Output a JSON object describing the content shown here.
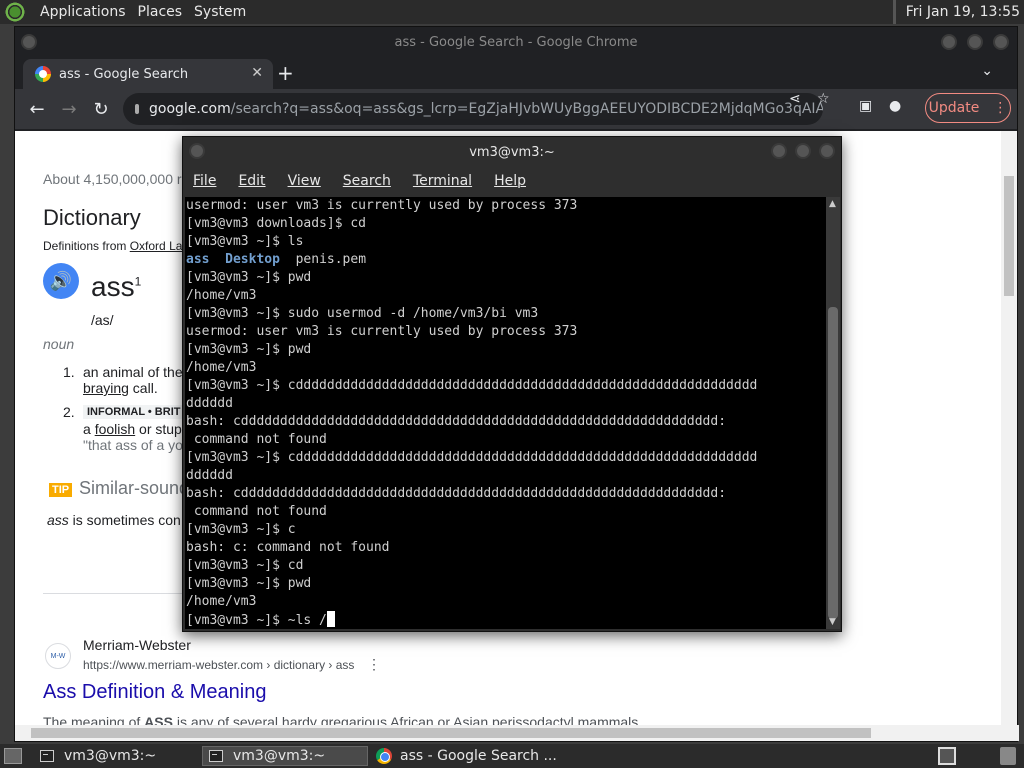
{
  "topbar": {
    "menus": [
      "Applications",
      "Places",
      "System"
    ],
    "clock": "Fri Jan 19, 13:55"
  },
  "chrome": {
    "window_title": "ass - Google Search - Google Chrome",
    "tab_title": "ass - Google Search",
    "url_host": "google.com",
    "url_rest": "/search?q=ass&oq=ass&gs_lcrp=EgZjaHJvbWUyBggAEEUYODIBCDE2MjdqMGo3qAIAs...",
    "update_label": "Update"
  },
  "page": {
    "results_count": "About 4,150,000,000 re",
    "dictionary_heading": "Dictionary",
    "definitions_from": "Definitions from",
    "definitions_source": "Oxford La",
    "word": "ass",
    "superscript": "1",
    "pronunciation": "/as/",
    "pos": "noun",
    "def1_num": "1.",
    "def1_line1": "an animal of the",
    "def1_link": "braying",
    "def1_line2": " call.",
    "def2_num": "2.",
    "def2_tag": "INFORMAL • BRIT",
    "def2_line1_pre": "a ",
    "def2_link": "foolish",
    "def2_line1_post": " or stup",
    "def2_example": "\"that ass of a yo",
    "tip_label": "TIP",
    "similar_heading": "Similar-sound",
    "similar_text_word": "ass",
    "similar_text_rest": " is sometimes con",
    "result_site": "Merriam-Webster",
    "result_favicon": "M-W",
    "result_url": "https://www.merriam-webster.com › dictionary › ass",
    "result_title": "Ass Definition & Meaning",
    "result_snippet_pre": "The meaning of ",
    "result_snippet_bold": "ASS",
    "result_snippet_post": " is any of several hardy gregarious African or Asian perissodactyl mammals"
  },
  "terminal": {
    "title": "vm3@vm3:~",
    "menu": [
      "File",
      "Edit",
      "View",
      "Search",
      "Terminal",
      "Help"
    ],
    "lines": [
      "usermod: user vm3 is currently used by process 373",
      "[vm3@vm3 downloads]$ cd",
      "[vm3@vm3 ~]$ ls",
      "",
      "[vm3@vm3 ~]$ pwd",
      "/home/vm3",
      "[vm3@vm3 ~]$ sudo usermod -d /home/vm3/bi vm3",
      "usermod: user vm3 is currently used by process 373",
      "[vm3@vm3 ~]$ pwd",
      "/home/vm3",
      "[vm3@vm3 ~]$ cddddddddddddddddddddddddddddddddddddddddddddddddddddddddddd",
      "dddddd",
      "bash: cddddddddddddddddddddddddddddddddddddddddddddddddddddddddddddd:",
      " command not found",
      "[vm3@vm3 ~]$ cddddddddddddddddddddddddddddddddddddddddddddddddddddddddddd",
      "dddddd",
      "bash: cddddddddddddddddddddddddddddddddddddddddddddddddddddddddddddd:",
      " command not found",
      "[vm3@vm3 ~]$ c",
      "bash: c: command not found",
      "[vm3@vm3 ~]$ cd",
      "[vm3@vm3 ~]$ pwd",
      "/home/vm3",
      "[vm3@vm3 ~]$ ~ls /"
    ],
    "ls_dir1": "ass",
    "ls_dir2": "Desktop",
    "ls_file": "penis.pem"
  },
  "taskbar": {
    "items": [
      "vm3@vm3:~",
      "vm3@vm3:~",
      "ass - Google Search ..."
    ]
  }
}
